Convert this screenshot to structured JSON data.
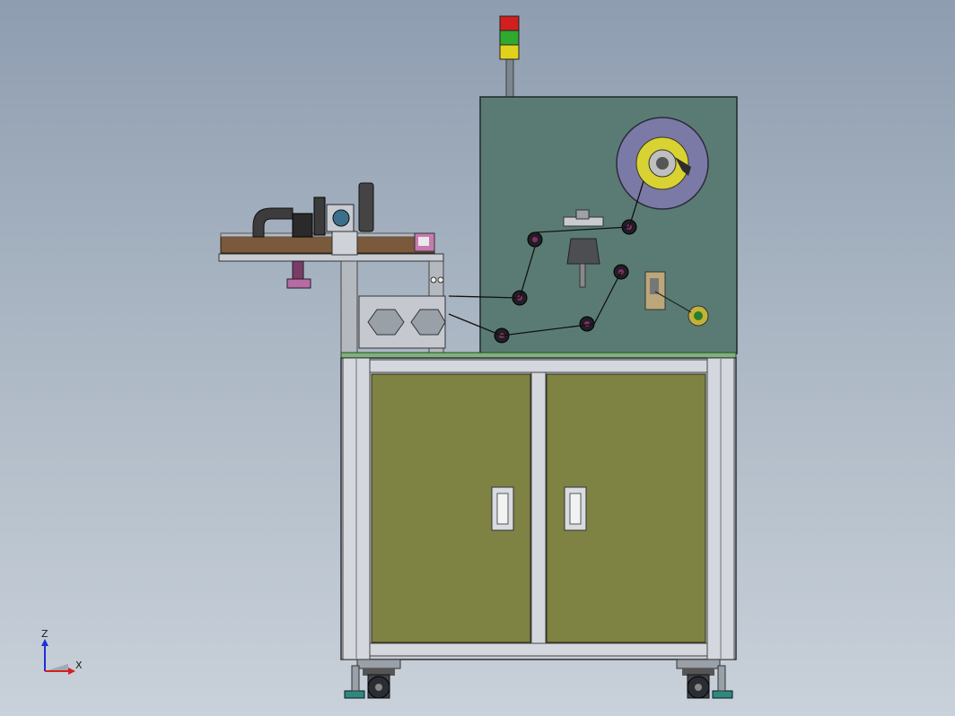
{
  "viewport": {
    "background_top": "#8e9db0",
    "background_bottom": "#c9d1da"
  },
  "machine": {
    "stack_light_colors": [
      "#d11f1f",
      "#2faa2f",
      "#e0d21a"
    ],
    "panel_color": "#5a7b73",
    "cabinet_door_color": "#7e8243",
    "frame_color": "#c7ccd3",
    "bed_color": "#7a5a3a"
  },
  "axis_triad": {
    "z_label": "Z",
    "x_label": "X",
    "z_color": "#1f2fd6",
    "x_color": "#d61f1f"
  }
}
